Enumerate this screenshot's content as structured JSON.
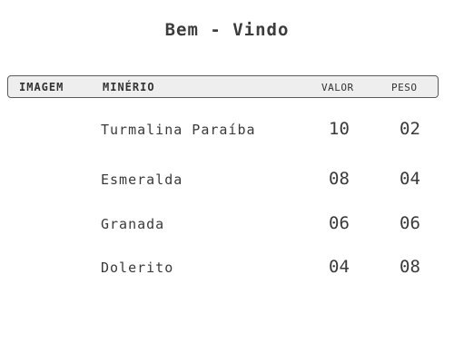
{
  "title": "Bem - Vindo",
  "table": {
    "headers": {
      "image": "IMAGEM",
      "mineral": "MINÉRIO",
      "value": "VALOR",
      "weight": "PESO"
    },
    "rows": [
      {
        "name": "Turmalina Paraíba",
        "value": "10",
        "weight": "02"
      },
      {
        "name": "Esmeralda",
        "value": "08",
        "weight": "04"
      },
      {
        "name": "Granada",
        "value": "06",
        "weight": "06"
      },
      {
        "name": "Dolerito",
        "value": "04",
        "weight": "08"
      }
    ]
  },
  "colors": {
    "text": "#3a3a3a",
    "header_bg": "#eeeeee",
    "header_border": "#5a5a5a",
    "background": "#ffffff"
  }
}
